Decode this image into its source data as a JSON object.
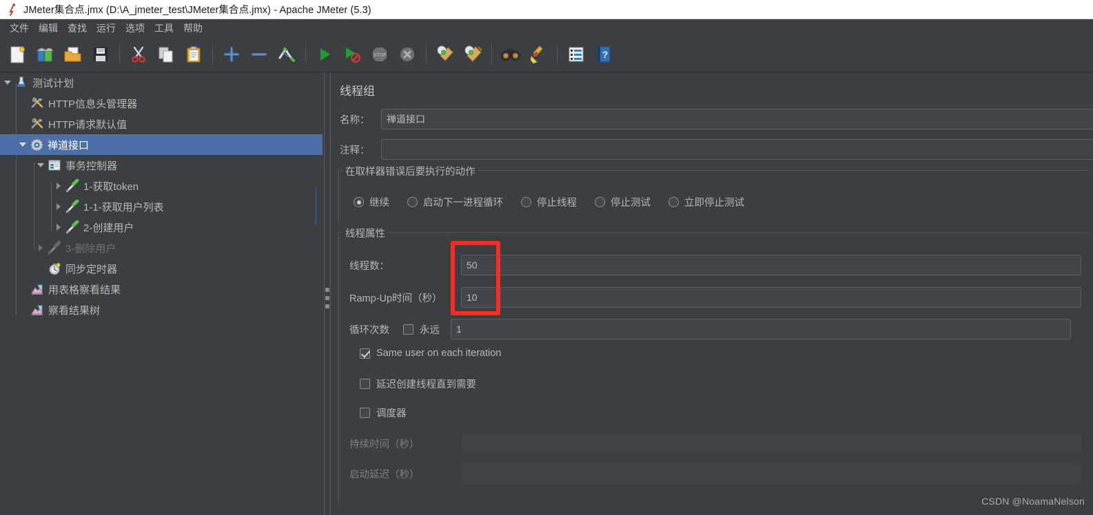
{
  "window": {
    "title": "JMeter集合点.jmx (D:\\A_jmeter_test\\JMeter集合点.jmx) - Apache JMeter (5.3)",
    "app_icon": "jmeter-feather-icon"
  },
  "menubar": {
    "items": [
      {
        "label": "文件",
        "name": "menu-file"
      },
      {
        "label": "编辑",
        "name": "menu-edit"
      },
      {
        "label": "查找",
        "name": "menu-search"
      },
      {
        "label": "运行",
        "name": "menu-run"
      },
      {
        "label": "选项",
        "name": "menu-options"
      },
      {
        "label": "工具",
        "name": "menu-tools"
      },
      {
        "label": "帮助",
        "name": "menu-help"
      }
    ]
  },
  "toolbar": {
    "buttons": [
      {
        "icon": "new-document-icon"
      },
      {
        "icon": "templates-icon"
      },
      {
        "icon": "open-folder-icon"
      },
      {
        "icon": "save-icon"
      },
      {
        "sep": true
      },
      {
        "icon": "cut-scissors-icon"
      },
      {
        "icon": "copy-icon"
      },
      {
        "icon": "paste-clipboard-icon"
      },
      {
        "sep": true
      },
      {
        "icon": "expand-plus-icon"
      },
      {
        "icon": "collapse-minus-icon"
      },
      {
        "icon": "toggle-enable-icon"
      },
      {
        "sep": true
      },
      {
        "icon": "start-play-icon"
      },
      {
        "icon": "start-no-pauses-icon"
      },
      {
        "icon": "stop-icon"
      },
      {
        "icon": "shutdown-icon"
      },
      {
        "sep": true
      },
      {
        "icon": "clear-icon"
      },
      {
        "icon": "clear-all-icon"
      },
      {
        "sep": true
      },
      {
        "icon": "search-binoculars-icon"
      },
      {
        "icon": "reset-search-broom-icon"
      },
      {
        "sep": true
      },
      {
        "icon": "function-helper-icon"
      },
      {
        "icon": "help-book-icon"
      }
    ]
  },
  "tree": {
    "nodes": [
      {
        "label": "测试计划",
        "icon": "test-plan-icon",
        "depth": 0,
        "twisty": "down",
        "selected": false,
        "dim": false
      },
      {
        "label": "HTTP信息头管理器",
        "icon": "header-manager-icon",
        "depth": 1,
        "twisty": "none",
        "selected": false,
        "dim": false
      },
      {
        "label": "HTTP请求默认值",
        "icon": "http-defaults-icon",
        "depth": 1,
        "twisty": "none",
        "selected": false,
        "dim": false
      },
      {
        "label": "禅道接口",
        "icon": "thread-group-icon",
        "depth": 1,
        "twisty": "down",
        "selected": true,
        "dim": false
      },
      {
        "label": "事务控制器",
        "icon": "transaction-controller-icon",
        "depth": 2,
        "twisty": "down",
        "selected": false,
        "dim": false
      },
      {
        "label": "1-获取token",
        "icon": "http-sampler-icon",
        "depth": 3,
        "twisty": "right",
        "selected": false,
        "dim": false
      },
      {
        "label": "1-1-获取用户列表",
        "icon": "http-sampler-icon",
        "depth": 3,
        "twisty": "right",
        "selected": false,
        "dim": false
      },
      {
        "label": "2-创建用户",
        "icon": "http-sampler-icon",
        "depth": 3,
        "twisty": "right",
        "selected": false,
        "dim": false
      },
      {
        "label": "3-删除用户",
        "icon": "http-sampler-disabled-icon",
        "depth": 2,
        "twisty": "right",
        "selected": false,
        "dim": true
      },
      {
        "label": "同步定时器",
        "icon": "sync-timer-icon",
        "depth": 2,
        "twisty": "none",
        "selected": false,
        "dim": false
      },
      {
        "label": "用表格察看结果",
        "icon": "view-results-table-icon",
        "depth": 1,
        "twisty": "none",
        "selected": false,
        "dim": false
      },
      {
        "label": "察看结果树",
        "icon": "view-results-tree-icon",
        "depth": 1,
        "twisty": "none",
        "selected": false,
        "dim": false
      }
    ]
  },
  "panel": {
    "title": "线程组",
    "name_label": "名称：",
    "name_value": "禅道接口",
    "comment_label": "注释：",
    "comment_value": "",
    "error_action": {
      "group_title": "在取样器错误后要执行的动作",
      "options": [
        {
          "label": "继续",
          "selected": true
        },
        {
          "label": "启动下一进程循环",
          "selected": false
        },
        {
          "label": "停止线程",
          "selected": false
        },
        {
          "label": "停止测试",
          "selected": false
        },
        {
          "label": "立即停止测试",
          "selected": false
        }
      ]
    },
    "thread_properties": {
      "group_title": "线程属性",
      "threads_label": "线程数：",
      "threads_value": "50",
      "rampup_label": "Ramp-Up时间（秒）",
      "rampup_value": "10",
      "loops_label": "循环次数",
      "forever_label": "永远",
      "forever_checked": false,
      "loops_value": "1",
      "same_user_label": "Same user on each iteration",
      "same_user_checked": true,
      "delay_create_label": "延迟创建线程直到需要",
      "delay_create_checked": false,
      "scheduler_label": "调度器",
      "scheduler_checked": false,
      "duration_label": "持续时间（秒）",
      "duration_value": "",
      "startup_delay_label": "启动延迟（秒）",
      "startup_delay_value": ""
    }
  },
  "annotation": {
    "highlight_color": "#fe2b20",
    "name": "thread-count-rampup-highlight"
  },
  "watermark": {
    "text": "CSDN @NoamaNelson"
  },
  "colors": {
    "window_bg": "#3c3f41",
    "titlebar_bg": "#ffffff",
    "selection_blue": "#4c6fa8",
    "text": "#b6b6b6",
    "accent_red": "#fe2b20"
  }
}
